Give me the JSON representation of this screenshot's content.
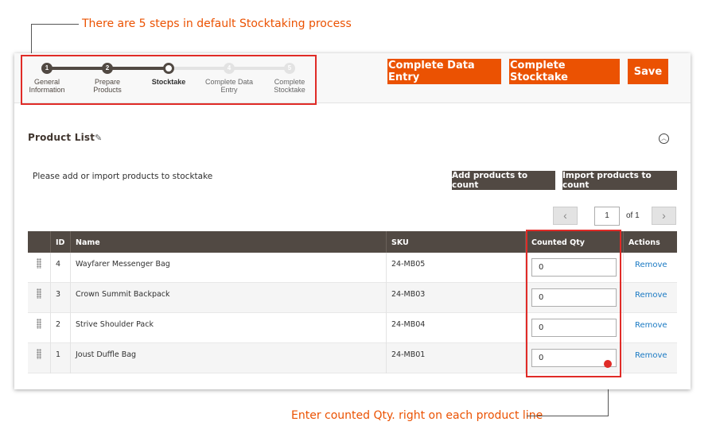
{
  "annotations": {
    "top": "There are 5 steps in default Stocktaking process",
    "bottom": "Enter counted Qty. right on each product line"
  },
  "steps": [
    {
      "num": "1",
      "label_line1": "General",
      "label_line2": "Information",
      "state": "done"
    },
    {
      "num": "2",
      "label_line1": "Prepare",
      "label_line2": "Products",
      "state": "done"
    },
    {
      "num": "",
      "label_line1": "Stocktake",
      "label_line2": "",
      "state": "current"
    },
    {
      "num": "4",
      "label_line1": "Complete Data",
      "label_line2": "Entry",
      "state": "todo"
    },
    {
      "num": "5",
      "label_line1": "Complete",
      "label_line2": "Stocktake",
      "state": "todo"
    }
  ],
  "toolbar": {
    "complete_data_entry": "Complete Data Entry",
    "complete_stocktake": "Complete Stocktake",
    "save": "Save"
  },
  "product_list": {
    "title": "Product List",
    "hint": "Please add or import products to stocktake",
    "add_button": "Add products to count",
    "import_button": "Import products to count"
  },
  "pager": {
    "current_page": "1",
    "of_text": "of 1",
    "prev_icon": "‹",
    "next_icon": "›"
  },
  "table": {
    "columns": {
      "id": "ID",
      "name": "Name",
      "sku": "SKU",
      "qty": "Counted Qty",
      "actions": "Actions"
    },
    "rows": [
      {
        "id": "4",
        "name": "Wayfarer Messenger Bag",
        "sku": "24-MB05",
        "qty": "0",
        "action": "Remove"
      },
      {
        "id": "3",
        "name": "Crown Summit Backpack",
        "sku": "24-MB03",
        "qty": "0",
        "action": "Remove"
      },
      {
        "id": "2",
        "name": "Strive Shoulder Pack",
        "sku": "24-MB04",
        "qty": "0",
        "action": "Remove"
      },
      {
        "id": "1",
        "name": "Joust Duffle Bag",
        "sku": "24-MB01",
        "qty": "0",
        "action": "Remove"
      }
    ]
  },
  "colors": {
    "accent": "#eb5202",
    "dark": "#514943",
    "highlight": "#e02b27",
    "link": "#1979c3"
  }
}
